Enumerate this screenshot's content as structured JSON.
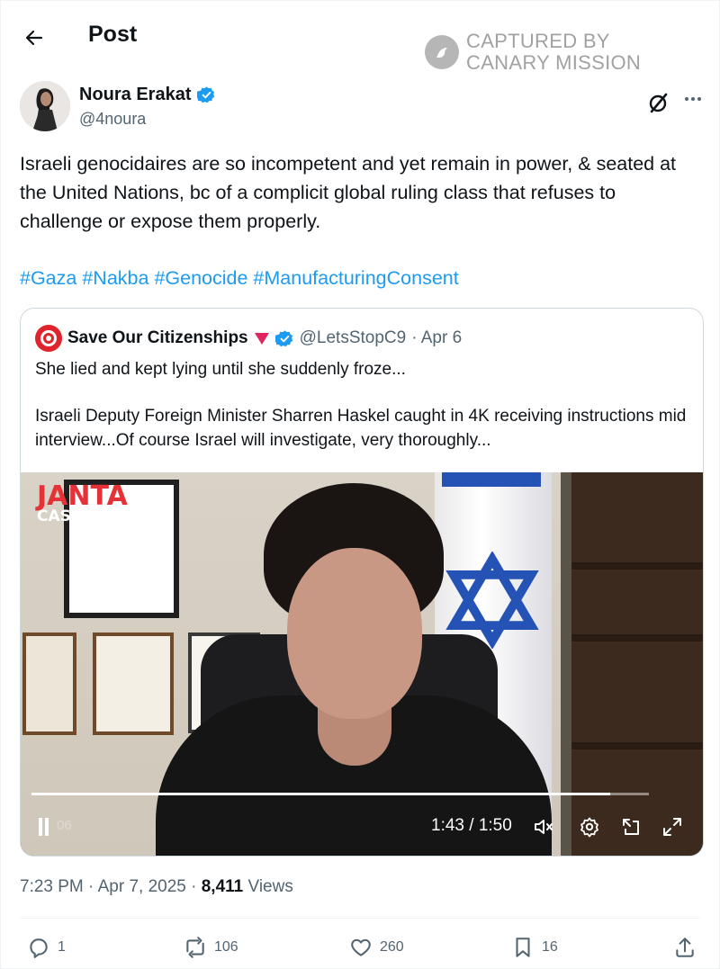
{
  "header": {
    "title": "Post",
    "watermark_line1": "CAPTURED BY",
    "watermark_line2": "CANARY MISSION"
  },
  "author": {
    "name": "Noura Erakat",
    "handle": "@4noura"
  },
  "post": {
    "text": "Israeli genocidaires are so incompetent and yet remain in power, & seated at the United Nations, bc of a complicit global ruling class that refuses to challenge or expose them properly.",
    "hashtags": [
      "#Gaza",
      "#Nakba",
      "#Genocide",
      "#ManufacturingConsent"
    ]
  },
  "quote": {
    "name": "Save Our Citizenships",
    "handle": "@LetsStopC9",
    "date": "· Apr 6",
    "line1": "She lied and kept lying until she suddenly froze...",
    "line2": "Israeli Deputy Foreign Minister Sharren Haskel caught in 4K receiving instructions mid interview...Of course Israel will investigate, very thoroughly..."
  },
  "video": {
    "logo_top": "JANTA",
    "logo_bottom": "CAST",
    "timestamp_overlay": "06",
    "time": "1:43 / 1:50",
    "progress": 0.937
  },
  "meta": {
    "time": "7:23 PM · Apr 7, 2025 · ",
    "views_count": "8,411",
    "views_label": " Views"
  },
  "actions": {
    "replies": "1",
    "reposts": "106",
    "likes": "260",
    "bookmarks": "16"
  },
  "colors": {
    "accent": "#1d9bf0",
    "secondary_text": "#536471",
    "verified": "#1d9bf0"
  }
}
